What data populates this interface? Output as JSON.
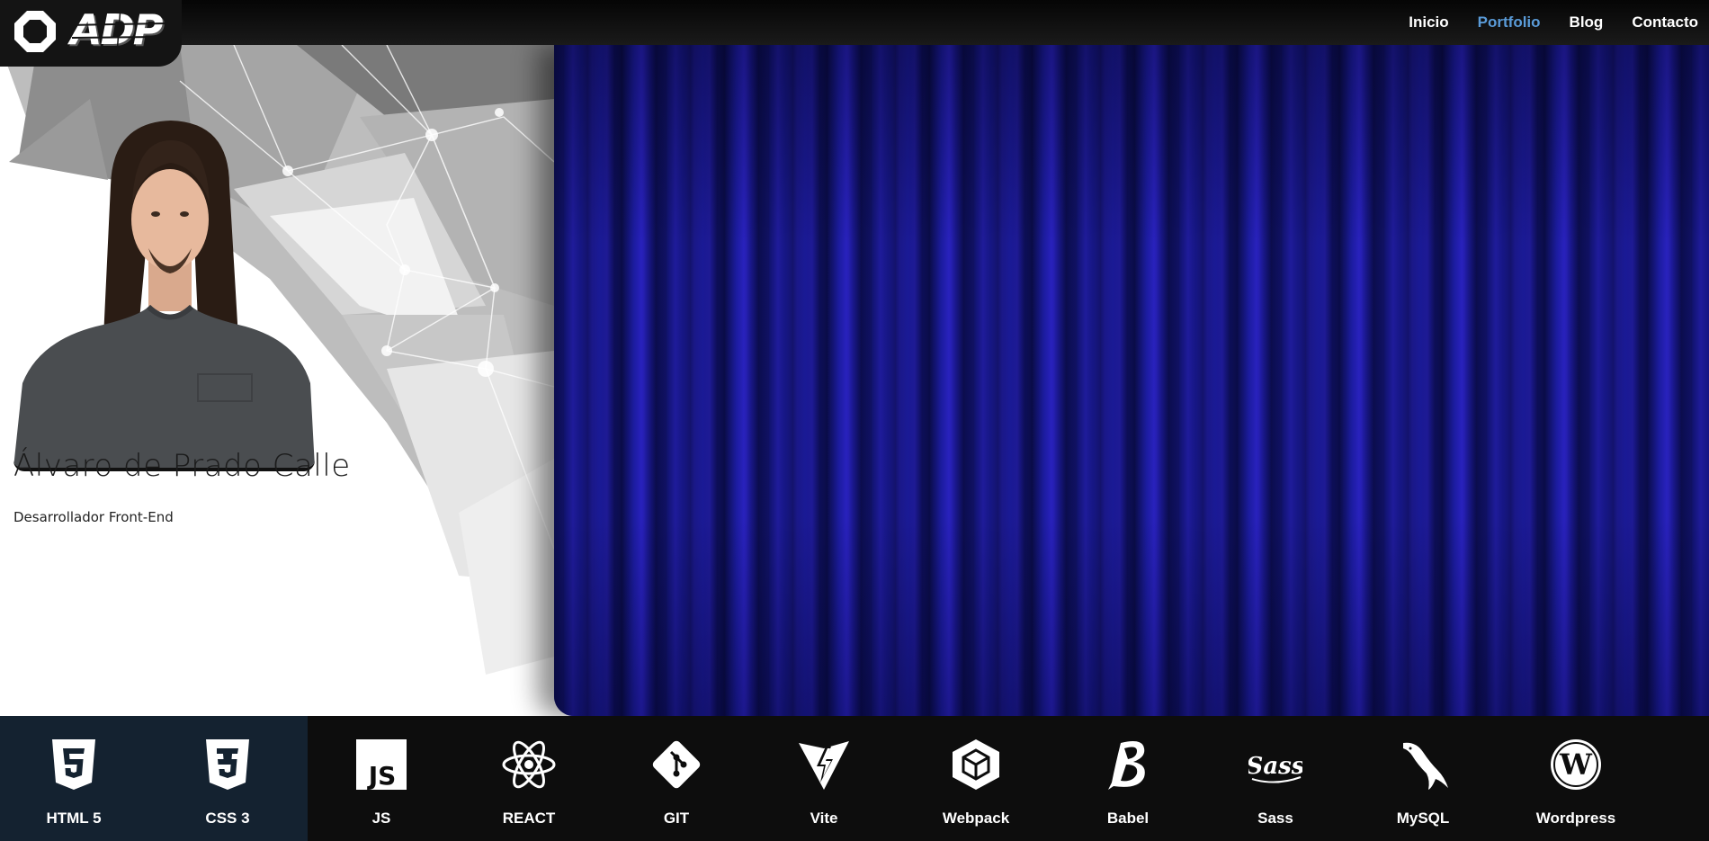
{
  "brand": {
    "logo_text": "ADP"
  },
  "nav": {
    "items": [
      {
        "label": "Inicio",
        "active": false
      },
      {
        "label": "Portfolio",
        "active": true
      },
      {
        "label": "Blog",
        "active": false
      },
      {
        "label": "Contacto",
        "active": false
      }
    ],
    "active_color": "#5a9bd8"
  },
  "profile": {
    "name": "Álvaro de Prado Calle",
    "role": "Desarrollador Front-End"
  },
  "stage": {
    "curtain_color": "#1a1aa8"
  },
  "tech": {
    "items": [
      {
        "label": "HTML 5",
        "icon": "html5-icon",
        "highlighted": true
      },
      {
        "label": "CSS 3",
        "icon": "css3-icon",
        "highlighted": true
      },
      {
        "label": "JS",
        "icon": "js-icon",
        "highlighted": false
      },
      {
        "label": "REACT",
        "icon": "react-icon",
        "highlighted": false
      },
      {
        "label": "GIT",
        "icon": "git-icon",
        "highlighted": false
      },
      {
        "label": "Vite",
        "icon": "vite-icon",
        "highlighted": false
      },
      {
        "label": "Webpack",
        "icon": "webpack-icon",
        "highlighted": false
      },
      {
        "label": "Babel",
        "icon": "babel-icon",
        "highlighted": false
      },
      {
        "label": "Sass",
        "icon": "sass-icon",
        "highlighted": false
      },
      {
        "label": "MySQL",
        "icon": "mysql-icon",
        "highlighted": false
      },
      {
        "label": "Wordpress",
        "icon": "wordpress-icon",
        "highlighted": false
      }
    ],
    "highlight_color": "#142230"
  }
}
